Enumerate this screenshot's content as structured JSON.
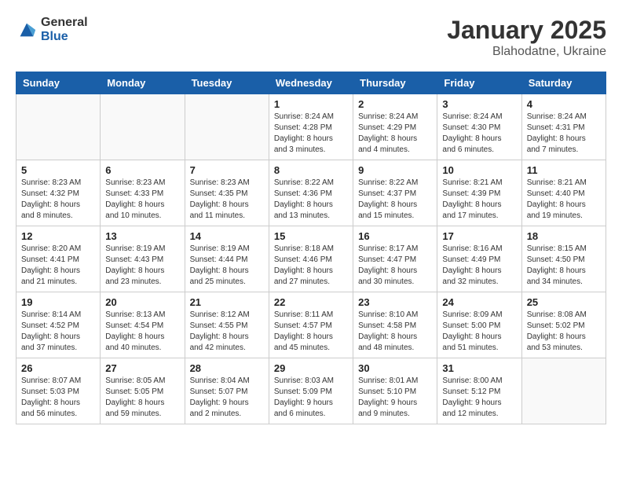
{
  "header": {
    "logo_general": "General",
    "logo_blue": "Blue",
    "main_title": "January 2025",
    "subtitle": "Blahodatne, Ukraine"
  },
  "weekdays": [
    "Sunday",
    "Monday",
    "Tuesday",
    "Wednesday",
    "Thursday",
    "Friday",
    "Saturday"
  ],
  "weeks": [
    [
      {
        "day": "",
        "info": ""
      },
      {
        "day": "",
        "info": ""
      },
      {
        "day": "",
        "info": ""
      },
      {
        "day": "1",
        "info": "Sunrise: 8:24 AM\nSunset: 4:28 PM\nDaylight: 8 hours\nand 3 minutes."
      },
      {
        "day": "2",
        "info": "Sunrise: 8:24 AM\nSunset: 4:29 PM\nDaylight: 8 hours\nand 4 minutes."
      },
      {
        "day": "3",
        "info": "Sunrise: 8:24 AM\nSunset: 4:30 PM\nDaylight: 8 hours\nand 6 minutes."
      },
      {
        "day": "4",
        "info": "Sunrise: 8:24 AM\nSunset: 4:31 PM\nDaylight: 8 hours\nand 7 minutes."
      }
    ],
    [
      {
        "day": "5",
        "info": "Sunrise: 8:23 AM\nSunset: 4:32 PM\nDaylight: 8 hours\nand 8 minutes."
      },
      {
        "day": "6",
        "info": "Sunrise: 8:23 AM\nSunset: 4:33 PM\nDaylight: 8 hours\nand 10 minutes."
      },
      {
        "day": "7",
        "info": "Sunrise: 8:23 AM\nSunset: 4:35 PM\nDaylight: 8 hours\nand 11 minutes."
      },
      {
        "day": "8",
        "info": "Sunrise: 8:22 AM\nSunset: 4:36 PM\nDaylight: 8 hours\nand 13 minutes."
      },
      {
        "day": "9",
        "info": "Sunrise: 8:22 AM\nSunset: 4:37 PM\nDaylight: 8 hours\nand 15 minutes."
      },
      {
        "day": "10",
        "info": "Sunrise: 8:21 AM\nSunset: 4:39 PM\nDaylight: 8 hours\nand 17 minutes."
      },
      {
        "day": "11",
        "info": "Sunrise: 8:21 AM\nSunset: 4:40 PM\nDaylight: 8 hours\nand 19 minutes."
      }
    ],
    [
      {
        "day": "12",
        "info": "Sunrise: 8:20 AM\nSunset: 4:41 PM\nDaylight: 8 hours\nand 21 minutes."
      },
      {
        "day": "13",
        "info": "Sunrise: 8:19 AM\nSunset: 4:43 PM\nDaylight: 8 hours\nand 23 minutes."
      },
      {
        "day": "14",
        "info": "Sunrise: 8:19 AM\nSunset: 4:44 PM\nDaylight: 8 hours\nand 25 minutes."
      },
      {
        "day": "15",
        "info": "Sunrise: 8:18 AM\nSunset: 4:46 PM\nDaylight: 8 hours\nand 27 minutes."
      },
      {
        "day": "16",
        "info": "Sunrise: 8:17 AM\nSunset: 4:47 PM\nDaylight: 8 hours\nand 30 minutes."
      },
      {
        "day": "17",
        "info": "Sunrise: 8:16 AM\nSunset: 4:49 PM\nDaylight: 8 hours\nand 32 minutes."
      },
      {
        "day": "18",
        "info": "Sunrise: 8:15 AM\nSunset: 4:50 PM\nDaylight: 8 hours\nand 34 minutes."
      }
    ],
    [
      {
        "day": "19",
        "info": "Sunrise: 8:14 AM\nSunset: 4:52 PM\nDaylight: 8 hours\nand 37 minutes."
      },
      {
        "day": "20",
        "info": "Sunrise: 8:13 AM\nSunset: 4:54 PM\nDaylight: 8 hours\nand 40 minutes."
      },
      {
        "day": "21",
        "info": "Sunrise: 8:12 AM\nSunset: 4:55 PM\nDaylight: 8 hours\nand 42 minutes."
      },
      {
        "day": "22",
        "info": "Sunrise: 8:11 AM\nSunset: 4:57 PM\nDaylight: 8 hours\nand 45 minutes."
      },
      {
        "day": "23",
        "info": "Sunrise: 8:10 AM\nSunset: 4:58 PM\nDaylight: 8 hours\nand 48 minutes."
      },
      {
        "day": "24",
        "info": "Sunrise: 8:09 AM\nSunset: 5:00 PM\nDaylight: 8 hours\nand 51 minutes."
      },
      {
        "day": "25",
        "info": "Sunrise: 8:08 AM\nSunset: 5:02 PM\nDaylight: 8 hours\nand 53 minutes."
      }
    ],
    [
      {
        "day": "26",
        "info": "Sunrise: 8:07 AM\nSunset: 5:03 PM\nDaylight: 8 hours\nand 56 minutes."
      },
      {
        "day": "27",
        "info": "Sunrise: 8:05 AM\nSunset: 5:05 PM\nDaylight: 8 hours\nand 59 minutes."
      },
      {
        "day": "28",
        "info": "Sunrise: 8:04 AM\nSunset: 5:07 PM\nDaylight: 9 hours\nand 2 minutes."
      },
      {
        "day": "29",
        "info": "Sunrise: 8:03 AM\nSunset: 5:09 PM\nDaylight: 9 hours\nand 6 minutes."
      },
      {
        "day": "30",
        "info": "Sunrise: 8:01 AM\nSunset: 5:10 PM\nDaylight: 9 hours\nand 9 minutes."
      },
      {
        "day": "31",
        "info": "Sunrise: 8:00 AM\nSunset: 5:12 PM\nDaylight: 9 hours\nand 12 minutes."
      },
      {
        "day": "",
        "info": ""
      }
    ]
  ]
}
